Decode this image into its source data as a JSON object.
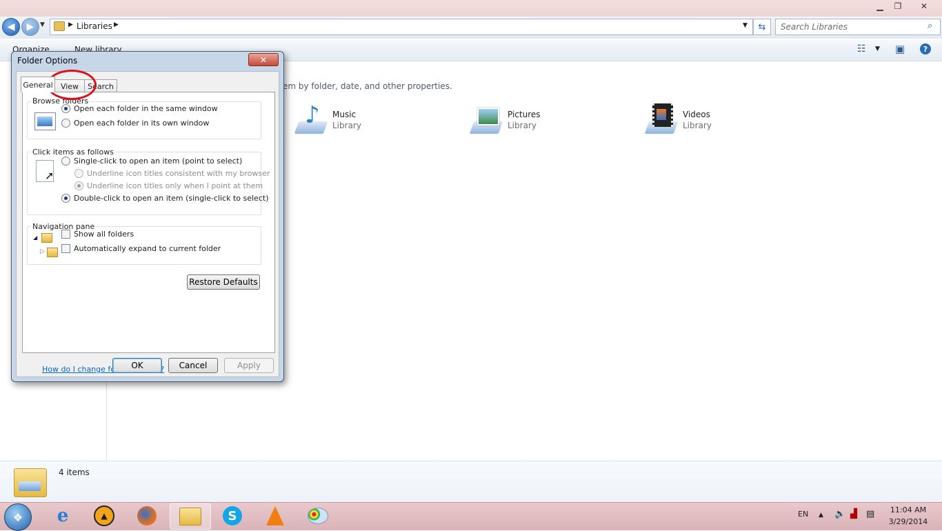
{
  "explorer": {
    "breadcrumb": "Libraries",
    "search_placeholder": "Search Libraries",
    "toolbar": {
      "organize": "Organize",
      "new_library": "New library"
    },
    "description": "em by folder, date, and other properties.",
    "libraries": [
      {
        "name": "Music",
        "type": "Library"
      },
      {
        "name": "Pictures",
        "type": "Library"
      },
      {
        "name": "Videos",
        "type": "Library"
      }
    ],
    "status": "4 items"
  },
  "dialog": {
    "title": "Folder Options",
    "close": "✕",
    "tabs": [
      "General",
      "View",
      "Search"
    ],
    "browse": {
      "title": "Browse folders",
      "options": [
        "Open each folder in the same window",
        "Open each folder in its own window"
      ],
      "selected": 0
    },
    "click": {
      "title": "Click items as follows",
      "single": "Single-click to open an item (point to select)",
      "underline_browser": "Underline icon titles consistent with my browser",
      "underline_point": "Underline icon titles only when I point at them",
      "double": "Double-click to open an item (single-click to select)"
    },
    "nav": {
      "title": "Navigation pane",
      "show_all": "Show all folders",
      "auto_expand": "Automatically expand to current folder"
    },
    "restore": "Restore Defaults",
    "help": "How do I change folder options?",
    "ok": "OK",
    "cancel": "Cancel",
    "apply": "Apply"
  },
  "taskbar": {
    "lang": "EN",
    "time": "11:04 AM",
    "date": "3/29/2014"
  }
}
